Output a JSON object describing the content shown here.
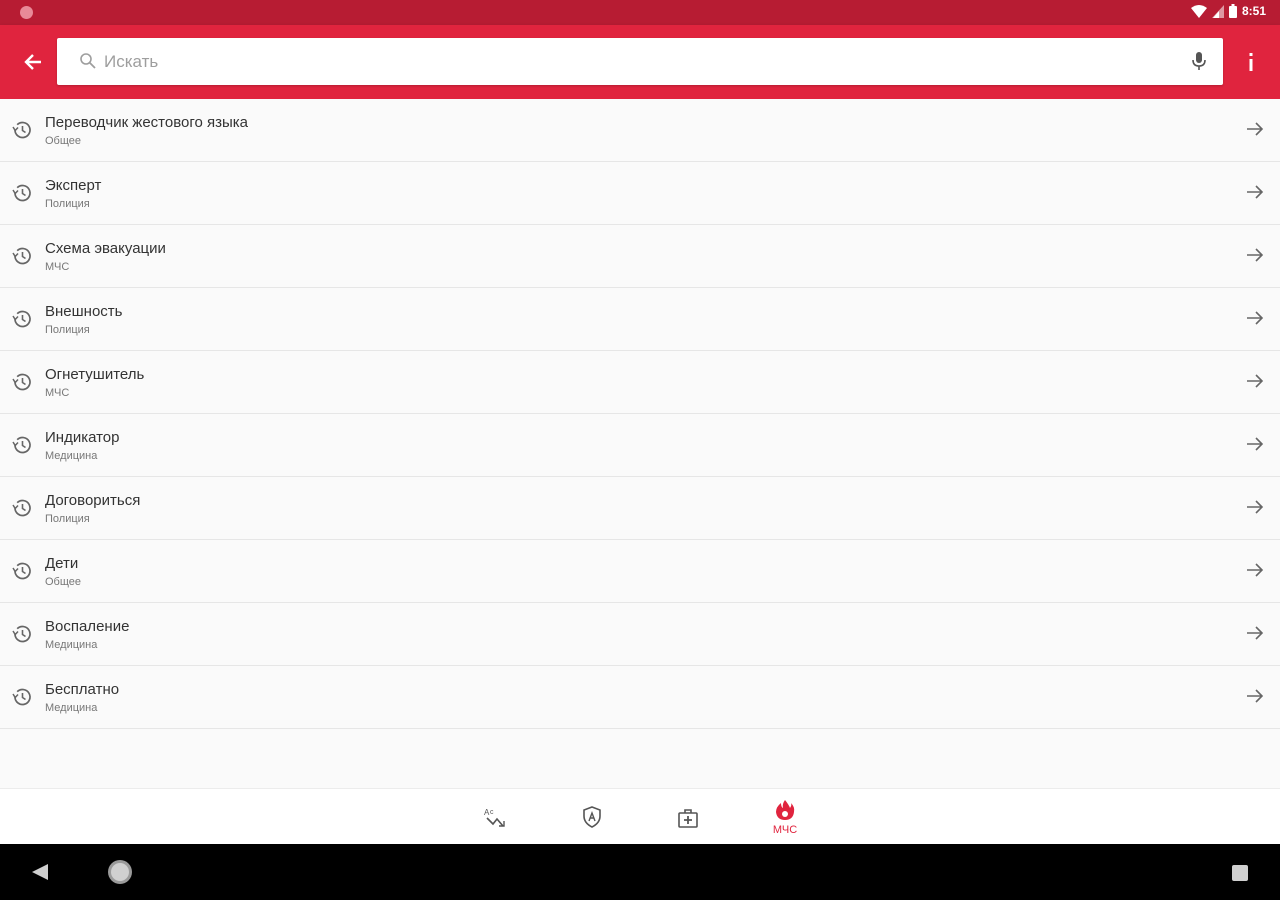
{
  "status_bar": {
    "time": "8:51"
  },
  "search": {
    "placeholder": "Искать",
    "value": ""
  },
  "history": [
    {
      "title": "Переводчик жестового языка",
      "category": "Общее"
    },
    {
      "title": "Эксперт",
      "category": "Полиция"
    },
    {
      "title": "Схема эвакуации",
      "category": "МЧС"
    },
    {
      "title": "Внешность",
      "category": "Полиция"
    },
    {
      "title": "Огнетушитель",
      "category": "МЧС"
    },
    {
      "title": "Индикатор",
      "category": "Медицина"
    },
    {
      "title": "Договориться",
      "category": "Полиция"
    },
    {
      "title": "Дети",
      "category": "Общее"
    },
    {
      "title": "Воспаление",
      "category": "Медицина"
    },
    {
      "title": "Бесплатно",
      "category": "Медицина"
    }
  ],
  "bottom_nav": {
    "items": [
      {
        "icon": "translate-icon",
        "label": ""
      },
      {
        "icon": "police-shield-icon",
        "label": ""
      },
      {
        "icon": "medical-kit-icon",
        "label": ""
      },
      {
        "icon": "fire-icon",
        "label": "МЧС",
        "active": true
      }
    ]
  },
  "colors": {
    "primary": "#e0243e",
    "status_bar": "#b71c33",
    "text": "#333333",
    "subtext": "#777777"
  }
}
